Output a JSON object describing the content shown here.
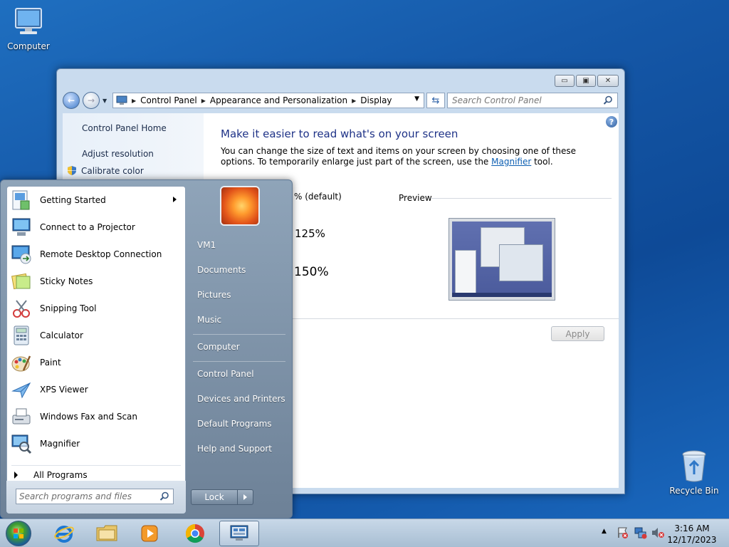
{
  "desktop": {
    "icons": [
      {
        "label": "Computer"
      },
      {
        "label": "Recycle Bin"
      }
    ]
  },
  "window": {
    "breadcrumb": [
      "Control Panel",
      "Appearance and Personalization",
      "Display"
    ],
    "search_placeholder": "Search Control Panel",
    "left_pane": {
      "home": "Control Panel Home",
      "adjust_resolution": "Adjust resolution",
      "calibrate_color": "Calibrate color"
    },
    "main": {
      "title": "Make it easier to read what's on your screen",
      "description_part1": "You can change the size of text and items on your screen by choosing one of these options. To temporarily enlarge just part of the screen, use the ",
      "description_link": "Magnifier",
      "description_part2": " tool.",
      "option_default": "% (default)",
      "option_125": "125%",
      "option_150": "150%",
      "preview_label": "Preview",
      "apply_label": "Apply"
    }
  },
  "start_menu": {
    "programs": [
      {
        "label": "Getting Started",
        "icon": "getting-started-icon",
        "has_submenu": true
      },
      {
        "label": "Connect to a Projector",
        "icon": "projector-icon",
        "has_submenu": false
      },
      {
        "label": "Remote Desktop Connection",
        "icon": "remote-desktop-icon",
        "has_submenu": false
      },
      {
        "label": "Sticky Notes",
        "icon": "sticky-notes-icon",
        "has_submenu": false
      },
      {
        "label": "Snipping Tool",
        "icon": "snipping-tool-icon",
        "has_submenu": false
      },
      {
        "label": "Calculator",
        "icon": "calculator-icon",
        "has_submenu": false
      },
      {
        "label": "Paint",
        "icon": "paint-icon",
        "has_submenu": false
      },
      {
        "label": "XPS Viewer",
        "icon": "xps-viewer-icon",
        "has_submenu": false
      },
      {
        "label": "Windows Fax and Scan",
        "icon": "fax-scan-icon",
        "has_submenu": false
      },
      {
        "label": "Magnifier",
        "icon": "magnifier-icon",
        "has_submenu": false
      }
    ],
    "all_programs": "All Programs",
    "search_placeholder": "Search programs and files",
    "right_items": [
      "VM1",
      "Documents",
      "Pictures",
      "Music",
      "Computer",
      "Control Panel",
      "Devices and Printers",
      "Default Programs",
      "Help and Support"
    ],
    "lock_label": "Lock"
  },
  "taskbar": {
    "time": "3:16 AM",
    "date": "12/17/2023"
  }
}
